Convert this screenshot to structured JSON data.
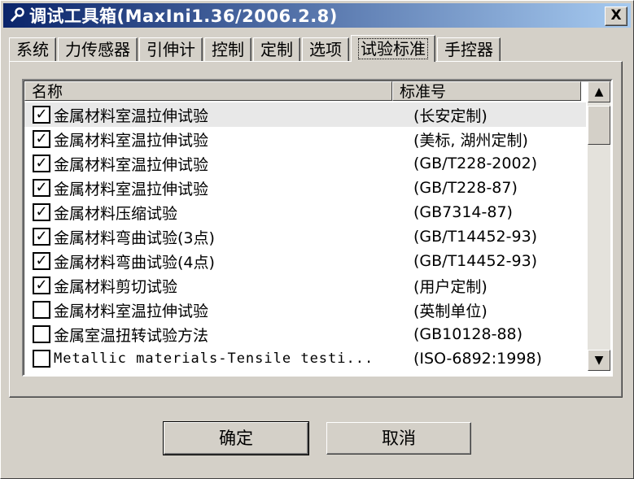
{
  "window": {
    "title": "调试工具箱(MaxIni1.36/2006.2.8)",
    "close_label": "X"
  },
  "tabs": [
    {
      "label": "系统"
    },
    {
      "label": "力传感器"
    },
    {
      "label": "引伸计"
    },
    {
      "label": "控制"
    },
    {
      "label": "定制"
    },
    {
      "label": "选项"
    },
    {
      "label": "试验标准",
      "active": true
    },
    {
      "label": "手控器"
    }
  ],
  "list": {
    "columns": [
      "名称",
      "标准号"
    ],
    "rows": [
      {
        "checked": true,
        "name": "金属材料室温拉伸试验",
        "std": "(长安定制)"
      },
      {
        "checked": true,
        "name": "金属材料室温拉伸试验",
        "std": "(美标, 湖州定制)"
      },
      {
        "checked": true,
        "name": "金属材料室温拉伸试验",
        "std": "(GB/T228-2002)"
      },
      {
        "checked": true,
        "name": "金属材料室温拉伸试验",
        "std": "(GB/T228-87)"
      },
      {
        "checked": true,
        "name": "金属材料压缩试验",
        "std": "(GB7314-87)"
      },
      {
        "checked": true,
        "name": "金属材料弯曲试验(3点)",
        "std": "(GB/T14452-93)"
      },
      {
        "checked": true,
        "name": "金属材料弯曲试验(4点)",
        "std": "(GB/T14452-93)"
      },
      {
        "checked": true,
        "name": "金属材料剪切试验",
        "std": "(用户定制)"
      },
      {
        "checked": false,
        "name": "金属材料室温拉伸试验",
        "std": "(英制单位)"
      },
      {
        "checked": false,
        "name": "金属室温扭转试验方法",
        "std": "(GB10128-88)"
      },
      {
        "checked": false,
        "name": "Metallic materials-Tensile testi...",
        "std": "(ISO-6892:1998)"
      }
    ]
  },
  "buttons": {
    "ok": "确定",
    "cancel": "取消"
  },
  "icons": {
    "title": "wrench-icon",
    "scroll_up": "arrow-up-icon",
    "scroll_down": "arrow-down-icon",
    "check": "checkmark-icon"
  }
}
